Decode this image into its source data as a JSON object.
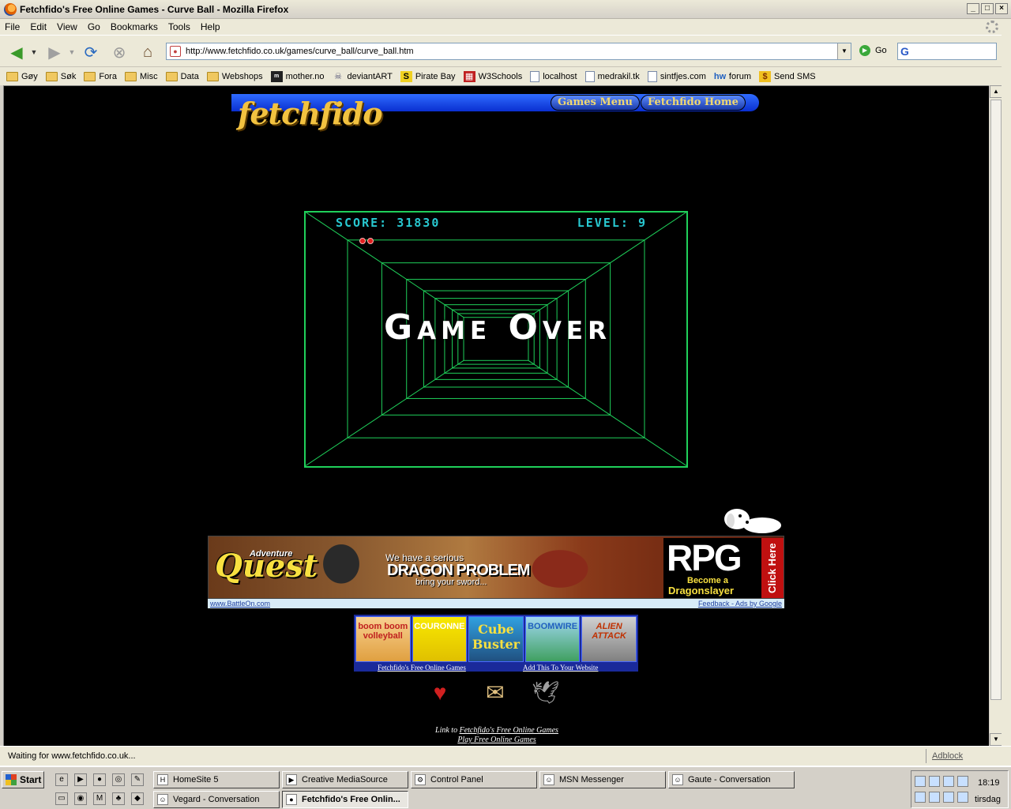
{
  "window": {
    "title": "Fetchfido's Free Online Games - Curve Ball - Mozilla Firefox",
    "controls": [
      "_",
      "□",
      "×"
    ]
  },
  "menu": [
    "File",
    "Edit",
    "View",
    "Go",
    "Bookmarks",
    "Tools",
    "Help"
  ],
  "nav": {
    "url": "http://www.fetchfido.co.uk/games/curve_ball/curve_ball.htm",
    "go_label": "Go",
    "search_placeholder": ""
  },
  "bookmarks": [
    {
      "label": "Gøy",
      "icon": "folder"
    },
    {
      "label": "Søk",
      "icon": "folder"
    },
    {
      "label": "Fora",
      "icon": "folder"
    },
    {
      "label": "Misc",
      "icon": "folder"
    },
    {
      "label": "Data",
      "icon": "folder"
    },
    {
      "label": "Webshops",
      "icon": "folder"
    },
    {
      "label": "mother.no",
      "icon": "site"
    },
    {
      "label": "deviantART",
      "icon": "site"
    },
    {
      "label": "Pirate Bay",
      "icon": "site"
    },
    {
      "label": "W3Schools",
      "icon": "site"
    },
    {
      "label": "localhost",
      "icon": "page"
    },
    {
      "label": "medrakil.tk",
      "icon": "page"
    },
    {
      "label": "sintfjes.com",
      "icon": "page"
    },
    {
      "label": "forum",
      "icon": "site"
    },
    {
      "label": "Send SMS",
      "icon": "site"
    }
  ],
  "site": {
    "logo": "fetchfido",
    "games_menu": "Games Menu",
    "home": "Fetchfido Home"
  },
  "game": {
    "score_label": "SCORE: 31830",
    "level_label": "LEVEL: 9",
    "lives": 2,
    "message": "Game Over",
    "border_color": "#1fd05a",
    "hud_color": "#28c8d0"
  },
  "ad": {
    "adventure": "Adventure",
    "quest": "Quest",
    "serious": "We have a serious",
    "dragon": "DRAGON PROBLEM",
    "sword": "bring your sword...",
    "rpg": "RPG",
    "become": "Become a",
    "dragonslayer": "Dragonslayer",
    "click_here": "Click Here",
    "left_link": "www.BattleOn.com",
    "right_link": "Feedback - Ads by Google"
  },
  "thumbs": [
    {
      "label": "boom boom volleyball"
    },
    {
      "label": "COURONNE"
    },
    {
      "label": "Cube Buster"
    },
    {
      "label": "BOOMWIRE"
    },
    {
      "label": "ALIEN ATTACK"
    }
  ],
  "thumb_links": {
    "left": "Fetchfido's Free Online Games",
    "right": "Add This To Your Website"
  },
  "linkto": {
    "prefix": "Link to ",
    "link1": "Fetchfido's Free Online Games",
    "link2": "Play Free Online Games"
  },
  "status": {
    "message": "Waiting for www.fetchfido.co.uk...",
    "adblock": "Adblock"
  },
  "taskbar": {
    "start": "Start",
    "buttons_row1": [
      "HomeSite 5",
      "Creative MediaSource",
      "Control Panel",
      "MSN Messenger",
      "Gaute - Conversation"
    ],
    "buttons_row2": [
      "Vegard - Conversation",
      "Fetchfido's Free Onlin..."
    ],
    "clock": "18:19",
    "day": "tirsdag"
  }
}
